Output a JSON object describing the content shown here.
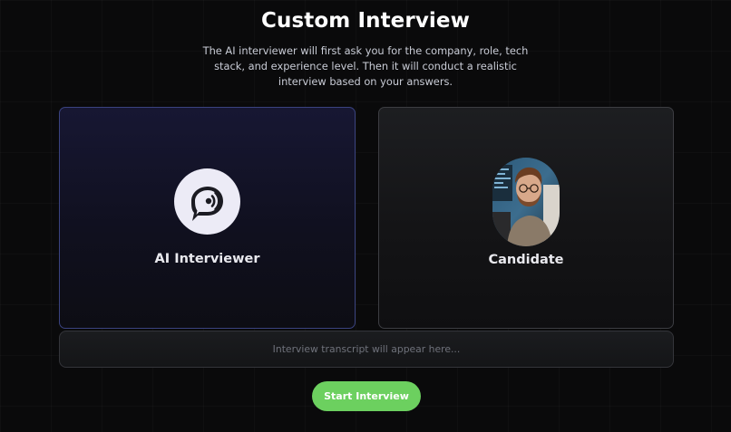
{
  "header": {
    "title": "Custom Interview",
    "description": "The AI interviewer will first ask you for the company, role, tech stack, and experience level. Then it will conduct a realistic interview based on your answers."
  },
  "cards": {
    "interviewer": {
      "label": "AI Interviewer",
      "icon": "chat-voice-icon"
    },
    "candidate": {
      "label": "Candidate",
      "avatar": "candidate-photo"
    }
  },
  "transcript": {
    "placeholder": "Interview transcript will appear here..."
  },
  "actions": {
    "start_label": "Start Interview"
  },
  "colors": {
    "accent_green": "#6cd05f",
    "ai_card_border": "#3a4380",
    "background": "#0a0a0b"
  }
}
